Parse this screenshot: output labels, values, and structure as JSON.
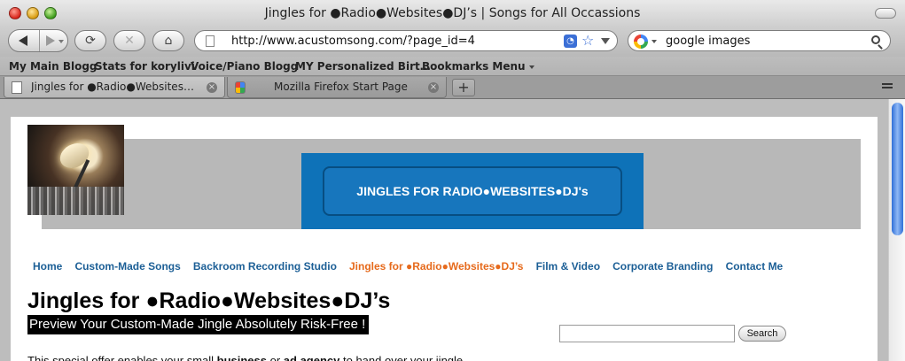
{
  "window": {
    "title": "Jingles for ●Radio●Websites●DJ’s | Songs for All Occassions"
  },
  "toolbar": {
    "reload_glyph": "⟳",
    "stop_glyph": "✕",
    "home_glyph": "⌂",
    "url": "http://www.acustomsong.com/?page_id=4",
    "rss_glyph": "◔",
    "star_glyph": "☆",
    "search_value": "google images"
  },
  "bookmarks": {
    "items": [
      {
        "label": "My Main Blogg"
      },
      {
        "label": "Stats for korylivi"
      },
      {
        "label": "Voice/Piano Blogg"
      },
      {
        "label": "MY Personalized Birt…"
      },
      {
        "label": "Bookmarks Menu"
      }
    ]
  },
  "tabs": {
    "items": [
      {
        "label": "Jingles for ●Radio●Websites●DJ…",
        "active": true
      },
      {
        "label": "Mozilla Firefox Start Page",
        "active": false
      }
    ],
    "close_glyph": "×",
    "new_tab_glyph": "+"
  },
  "site": {
    "banner_text": "JINGLES FOR RADIO●WEBSITES●DJ's",
    "nav": [
      {
        "label": "Home"
      },
      {
        "label": "Custom-Made Songs"
      },
      {
        "label": "Backroom Recording Studio"
      },
      {
        "label": "Jingles for ●Radio●Websites●DJ’s",
        "current": true
      },
      {
        "label": "Film & Video"
      },
      {
        "label": "Corporate Branding"
      },
      {
        "label": "Contact Me"
      }
    ],
    "post_title": "Jingles for ●Radio●Websites●DJ’s",
    "subtitle": "Preview Your Custom-Made Jingle Absolutely Risk-Free !",
    "body_partial_1": "This special offer enables your  small ",
    "body_bold_1": "business",
    "body_partial_2": " or ",
    "body_bold_2": "ad agency",
    "body_partial_3": " to hand over your jingle",
    "search_button": "Search"
  },
  "colors": {
    "nav_link": "#1c5f96",
    "nav_current": "#e66a1c",
    "banner_blue": "#0e72b8",
    "header_band": "#b8b8b8"
  }
}
